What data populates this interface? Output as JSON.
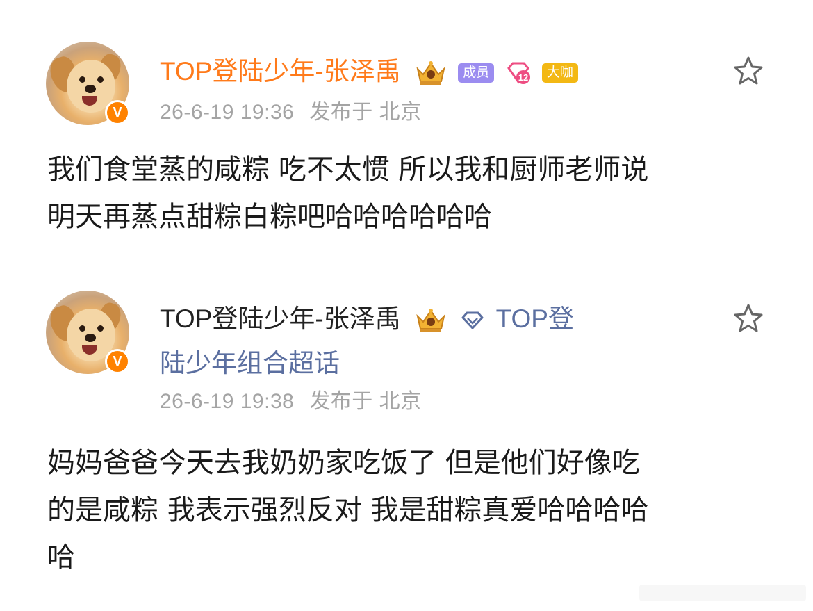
{
  "posts": [
    {
      "author": "TOP登陆少年-张泽禹",
      "badges": {
        "member": "成员",
        "level": "12",
        "vip": "大咖"
      },
      "verified_mark": "V",
      "timestamp": "26-6-19 19:36",
      "location": "发布于 北京",
      "body_lines": [
        "我们食堂蒸的咸粽 吃不太惯 所以我和厨师老师说",
        "明天再蒸点甜粽白粽吧哈哈哈哈哈哈"
      ],
      "name_color": "#ff7a1a",
      "icons": [
        "crown-badge-icon",
        "gem-level-icon",
        "star-icon"
      ]
    },
    {
      "author": "TOP登陆少年-张泽禹",
      "verified_mark": "V",
      "topic_line1": "TOP登",
      "topic_line2": "陆少年组合超话",
      "timestamp": "26-6-19 19:38",
      "location": "发布于 北京",
      "body_lines": [
        "妈妈爸爸今天去我奶奶家吃饭了 但是他们好像吃",
        "的是咸粽 我表示强烈反对 我是甜粽真爱哈哈哈哈",
        "哈"
      ],
      "name_color": "#222222",
      "topic_color": "#5b6fa0",
      "icons": [
        "crown-badge-icon",
        "diamond-topic-icon",
        "star-icon"
      ]
    }
  ],
  "colors": {
    "verified": "#ff8200",
    "meta": "#a4a4a4",
    "member_tag": "#9b8cf0",
    "vip_tag": "#f3b814"
  }
}
